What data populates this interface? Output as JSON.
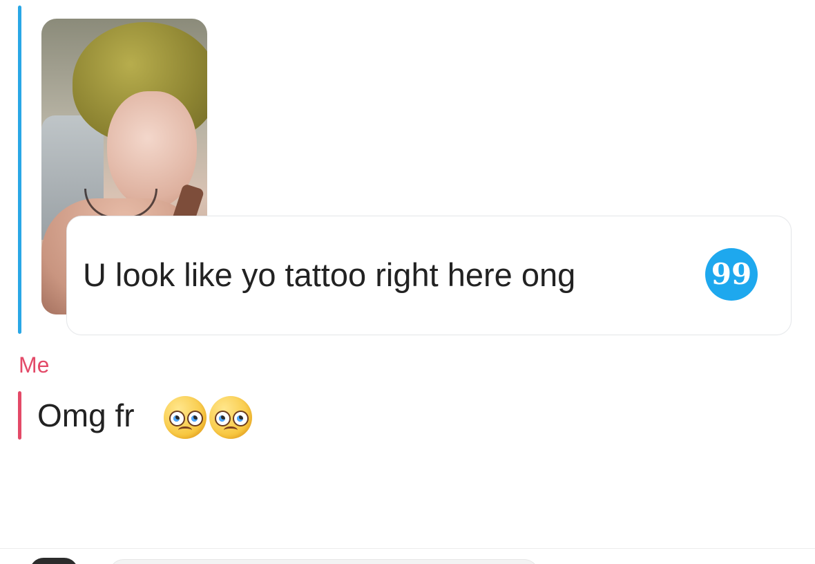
{
  "thread": {
    "quoted_message": {
      "text": "U look like yo tattoo right here ong",
      "quote_icon": "99"
    },
    "reply": {
      "sender": "Me",
      "text": "Omg fr",
      "emoji_count": 2,
      "emoji_name": "pleading-face"
    }
  },
  "colors": {
    "quote_bar": "#2aa7e6",
    "reply_accent": "#e34a68",
    "quote_button": "#1ea8ee",
    "text": "#222222",
    "background": "#ffffff"
  }
}
